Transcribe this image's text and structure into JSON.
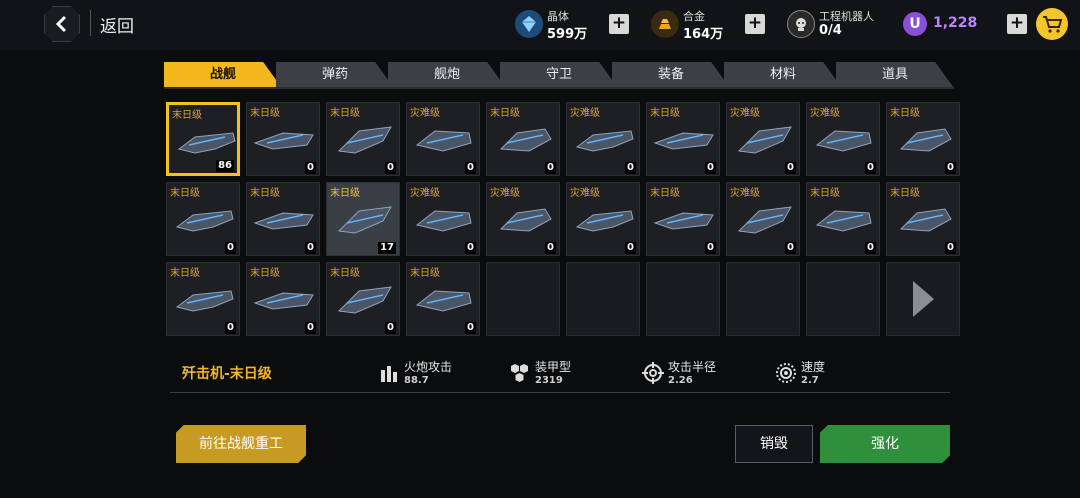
{
  "header": {
    "back_label": "返回",
    "resources": [
      {
        "name": "晶体",
        "value": "599万",
        "icon": "crystal-icon"
      },
      {
        "name": "合金",
        "value": "164万",
        "icon": "alloy-icon"
      },
      {
        "name": "工程机器人",
        "value": "0/4",
        "icon": "robot-icon"
      }
    ],
    "u_currency": {
      "value": "1,228",
      "icon": "u-currency-icon",
      "color": "#8a4fd8"
    }
  },
  "tabs": [
    "战舰",
    "弹药",
    "舰炮",
    "守卫",
    "装备",
    "材料",
    "道具"
  ],
  "active_tab": "战舰",
  "grid": {
    "rows": [
      [
        {
          "grade": "末日级",
          "count": "86",
          "selected": true
        },
        {
          "grade": "末日级",
          "count": "0"
        },
        {
          "grade": "末日级",
          "count": "0"
        },
        {
          "grade": "灾难级",
          "count": "0"
        },
        {
          "grade": "末日级",
          "count": "0"
        },
        {
          "grade": "灾难级",
          "count": "0"
        },
        {
          "grade": "末日级",
          "count": "0"
        },
        {
          "grade": "灾难级",
          "count": "0"
        },
        {
          "grade": "灾难级",
          "count": "0"
        },
        {
          "grade": "末日级",
          "count": "0"
        }
      ],
      [
        {
          "grade": "末日级",
          "count": "0"
        },
        {
          "grade": "末日级",
          "count": "0"
        },
        {
          "grade": "末日级",
          "count": "17",
          "highlight": true
        },
        {
          "grade": "灾难级",
          "count": "0"
        },
        {
          "grade": "灾难级",
          "count": "0"
        },
        {
          "grade": "灾难级",
          "count": "0"
        },
        {
          "grade": "末日级",
          "count": "0"
        },
        {
          "grade": "灾难级",
          "count": "0"
        },
        {
          "grade": "末日级",
          "count": "0"
        },
        {
          "grade": "末日级",
          "count": "0"
        }
      ],
      [
        {
          "grade": "末日级",
          "count": "0"
        },
        {
          "grade": "末日级",
          "count": "0"
        },
        {
          "grade": "末日级",
          "count": "0"
        },
        {
          "grade": "末日级",
          "count": "0"
        }
      ]
    ],
    "next_page_icon": "next-arrow-icon"
  },
  "info": {
    "ship_name": "歼击机-末日级",
    "stats": [
      {
        "label": "火炮攻击",
        "value": "88.7",
        "icon": "shells-icon"
      },
      {
        "label": "装甲型",
        "value": "2319",
        "icon": "armor-icon"
      },
      {
        "label": "攻击半径",
        "value": "2.26",
        "icon": "crosshair-icon"
      },
      {
        "label": "速度",
        "value": "2.7",
        "icon": "speed-icon"
      }
    ]
  },
  "buttons": {
    "foundry": "前往战舰重工",
    "dismantle": "销毁",
    "upgrade": "强化"
  },
  "colors": {
    "accent": "#f3b81e",
    "upgrade": "#2f8f3a",
    "foundry": "#c79b22"
  }
}
